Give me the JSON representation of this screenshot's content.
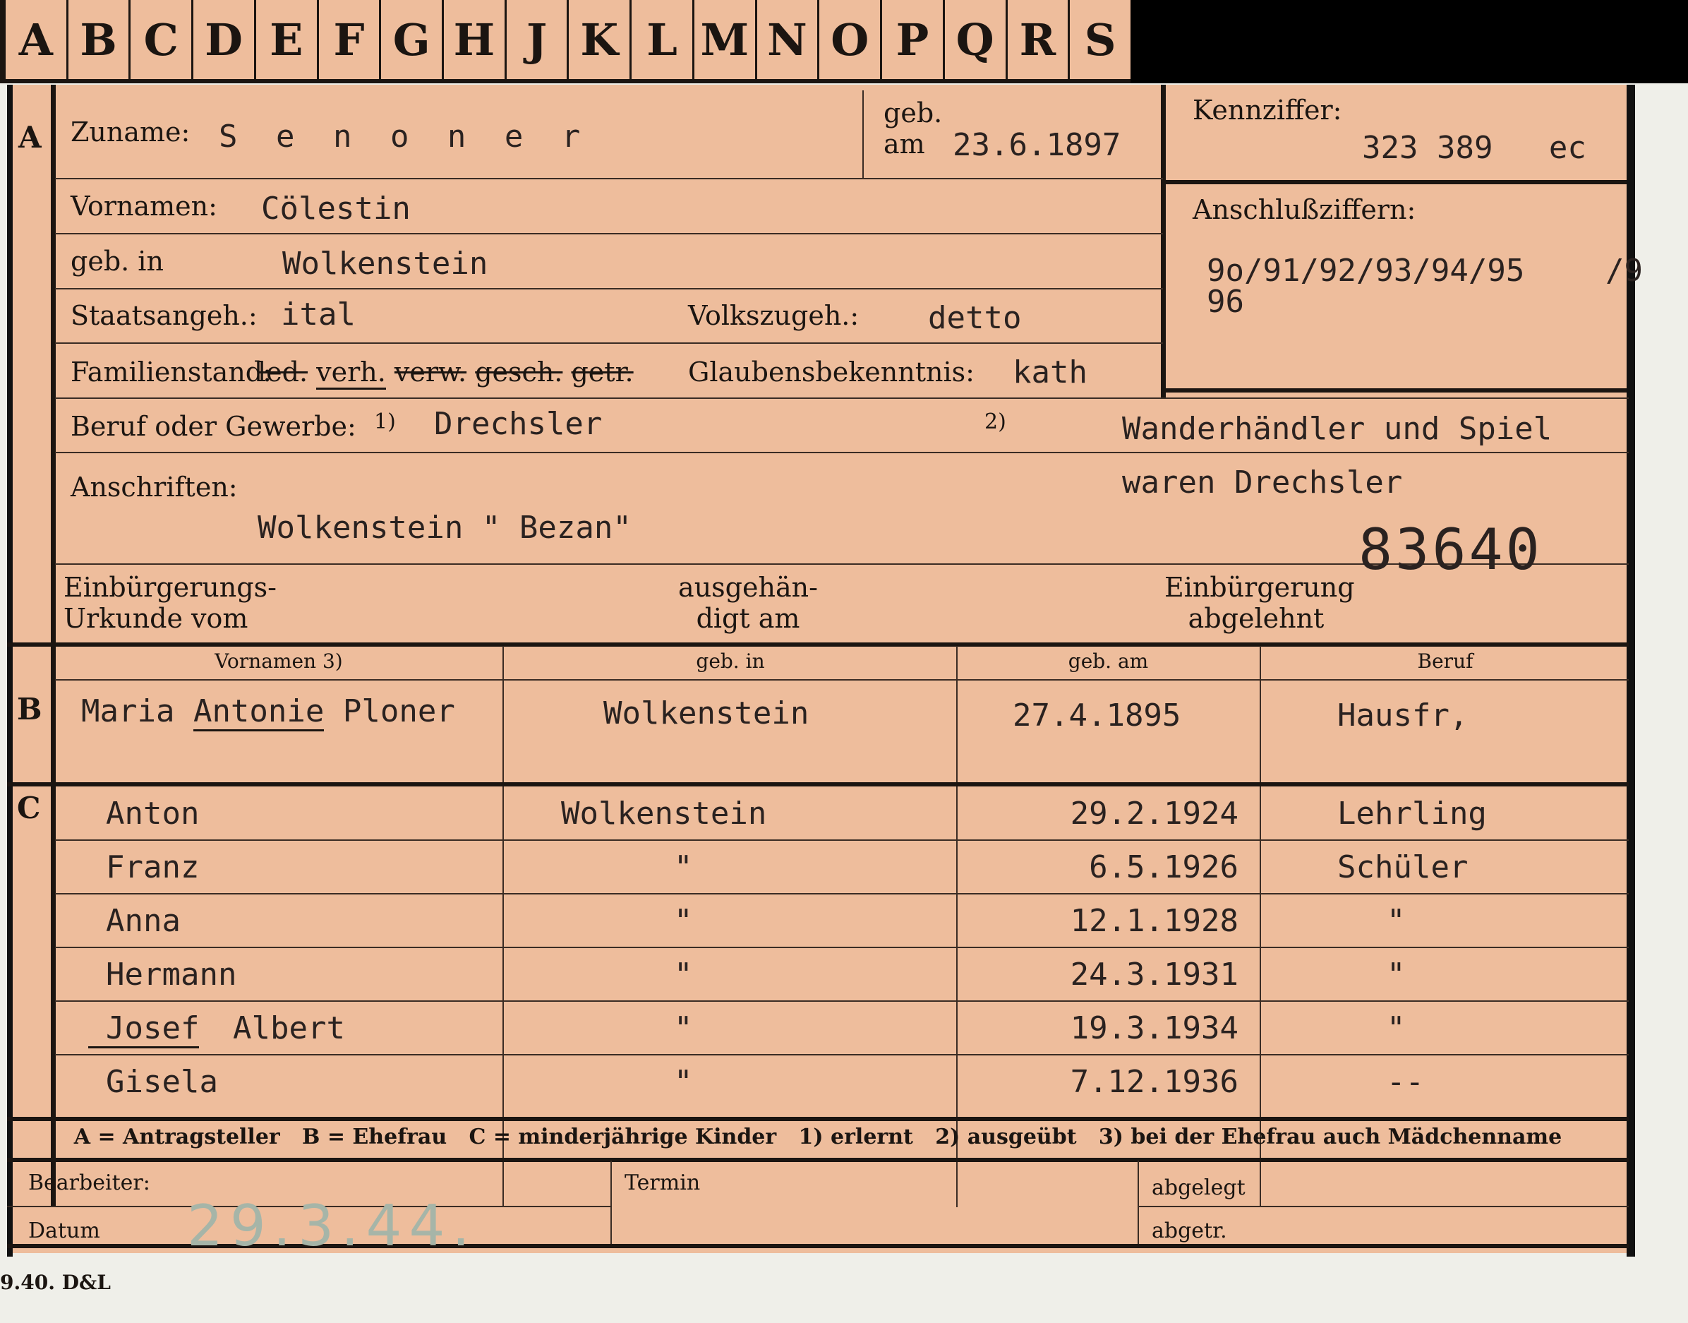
{
  "tabs": [
    "A",
    "B",
    "C",
    "D",
    "E",
    "F",
    "G",
    "H",
    "J",
    "K",
    "L",
    "M",
    "N",
    "O",
    "P",
    "Q",
    "R",
    "S"
  ],
  "section_a": {
    "marker": "A",
    "zuname_label": "Zuname:",
    "zuname": "S e n o n e r",
    "geb_label": "geb.",
    "am_label": "am",
    "geb_am": "23.6.1897",
    "kennziffer_label": "Kennziffer:",
    "kennziffer": "323 389   ec",
    "vornamen_label": "Vornamen:",
    "vornamen": "Cölestin",
    "geb_in_label": "geb. in",
    "geb_in": "Wolkenstein",
    "anschlussziffern_label": "Anschlußziffern:",
    "anschlussziffern_line1": "9o/91/92/93/94/95",
    "anschlussziffern_line1_end": "/9",
    "anschlussziffern_line2": "96",
    "staatsangeh_label": "Staatsangeh.:",
    "staatsangeh": "ital",
    "volkszugeh_label": "Volkszugeh.:",
    "volkszugeh": "detto",
    "familienstand_label": "Familienstand:",
    "familienstand_options": {
      "led": "led.",
      "verh": "verh.",
      "verw": "verw.",
      "gesch": "gesch.",
      "getr": "getr."
    },
    "glaubensbekenntnis_label": "Glaubensbekenntnis:",
    "glaubensbekenntnis": "kath",
    "beruf_label": "Beruf oder Gewerbe:",
    "fn1": "1)",
    "beruf1": "Drechsler",
    "fn2": "2)",
    "beruf2_line1": "Wanderhändler und Spiel",
    "beruf2_line2": "waren Drechsler",
    "anschriften_label": "Anschriften:",
    "anschrift": "Wolkenstein \" Bezan\"",
    "stamp_number": "83640",
    "einbuergerung_urkunde_label_1": "Einbürgerungs-",
    "einbuergerung_urkunde_label_2": "Urkunde vom",
    "ausgehaendigt_label_1": "ausgehän-",
    "ausgehaendigt_label_2": "digt am",
    "einbuergerung_abgelehnt_label_1": "Einbürgerung",
    "einbuergerung_abgelehnt_label_2": "abgelehnt"
  },
  "section_b": {
    "marker": "B",
    "headers": {
      "vornamen": "Vornamen 3)",
      "geb_in": "geb. in",
      "geb_am": "geb. am",
      "beruf": "Beruf"
    },
    "vornamen_pre": "Maria ",
    "vornamen_underlined": "Antonie",
    "vornamen_post": " Ploner",
    "geb_in": "Wolkenstein",
    "geb_am": "27.4.1895",
    "beruf": "Hausfr,"
  },
  "section_c": {
    "marker": "C",
    "children": [
      {
        "name": "Anton",
        "place": "Wolkenstein",
        "date": "29.2.1924",
        "job": "Lehrling"
      },
      {
        "name": "Franz",
        "place": "\"",
        "date": "6.5.1926",
        "job": "Schüler"
      },
      {
        "name": "Anna",
        "place": "\"",
        "date": "12.1.1928",
        "job": "\""
      },
      {
        "name": "Hermann",
        "place": "\"",
        "date": "24.3.1931",
        "job": "\""
      },
      {
        "name": "Josef",
        "name_rest": " Albert",
        "place": "\"",
        "date": "19.3.1934",
        "job": "\""
      },
      {
        "name": "Gisela",
        "place": "\"",
        "date": "7.12.1936",
        "job": "--"
      }
    ]
  },
  "legend": "A = Antragsteller   B = Ehefrau   C = minderjährige Kinder   1) erlernt   2) ausgeübt   3) bei der Ehefrau auch Mädchenname",
  "footer": {
    "bearbeiter_label": "Bearbeiter:",
    "datum_label": "Datum",
    "datum_value": "29.3.44.",
    "termin_label": "Termin",
    "abgelegt_label": "abgelegt",
    "abgetr_label": "abgetr."
  },
  "printer_mark": "9.40. D&L",
  "colors": {
    "card": "#eebd9c",
    "ink": "#1b1511",
    "pencil": "#a6b5a8"
  }
}
